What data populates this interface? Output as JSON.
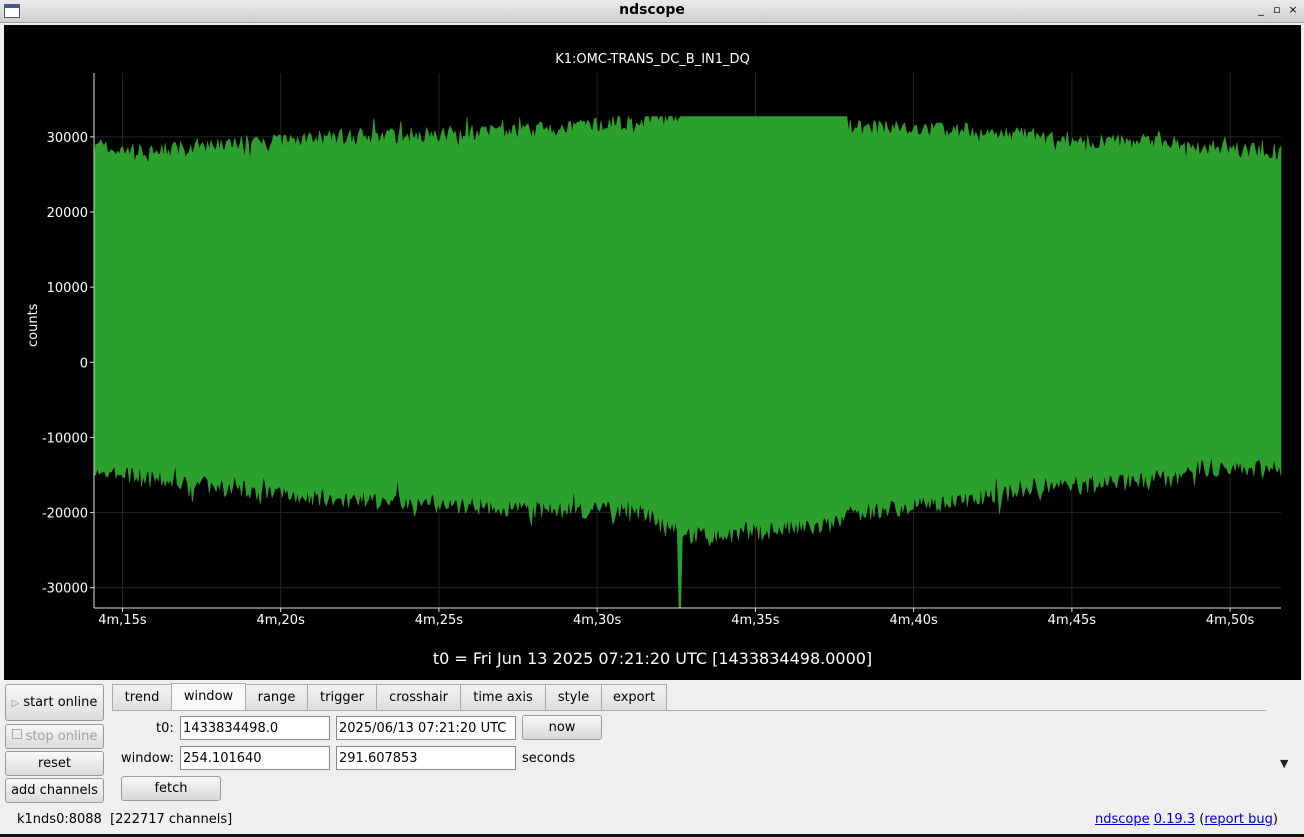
{
  "window": {
    "title": "ndscope",
    "controls": [
      "_",
      "▫",
      "×"
    ]
  },
  "plot": {
    "title": "K1:OMC-TRANS_DC_B_IN1_DQ",
    "ylabel": "counts",
    "t0_text": "t0 = Fri Jun 13 2025 07:21:20 UTC [1433834498.0000]",
    "trace_color": "#2ca02c"
  },
  "chart_data": {
    "type": "area",
    "title": "K1:OMC-TRANS_DC_B_IN1_DQ",
    "xlabel": "",
    "ylabel": "counts",
    "x_tick_labels": [
      "4m,15s",
      "4m,20s",
      "4m,25s",
      "4m,30s",
      "4m,35s",
      "4m,40s",
      "4m,45s",
      "4m,50s"
    ],
    "x_ticks_seconds": [
      255,
      260,
      265,
      270,
      275,
      280,
      285,
      290
    ],
    "y_tick_labels": [
      "30000",
      "20000",
      "10000",
      "0",
      "-10000",
      "-20000",
      "-30000"
    ],
    "y_ticks": [
      30000,
      20000,
      10000,
      0,
      -10000,
      -20000,
      -30000
    ],
    "xlim": [
      254.10164,
      291.607853
    ],
    "ylim": [
      -32700,
      38500
    ],
    "grid": true,
    "series": [
      {
        "color": "#2ca02c",
        "envelope_x": [
          254.1,
          256,
          258,
          260,
          262,
          264,
          266,
          268,
          270,
          271.5,
          272.6,
          273,
          274,
          275,
          276,
          277,
          277.8,
          278,
          280,
          282,
          284,
          286,
          288,
          289,
          291.6
        ],
        "envelope_max": [
          28500,
          28000,
          29000,
          29500,
          30000,
          30200,
          30500,
          30800,
          31500,
          32000,
          32700,
          32700,
          32700,
          32700,
          32700,
          32700,
          32700,
          31200,
          31000,
          30800,
          30000,
          29300,
          29200,
          28500,
          28000
        ],
        "envelope_min": [
          -14500,
          -15500,
          -16500,
          -17500,
          -18000,
          -18500,
          -19000,
          -19500,
          -19500,
          -20000,
          -22000,
          -23000,
          -23000,
          -22500,
          -22000,
          -22000,
          -21000,
          -20000,
          -19000,
          -18000,
          -16500,
          -16000,
          -15500,
          -14000,
          -14000
        ]
      }
    ]
  },
  "sidebar": {
    "start_online": "start online",
    "stop_online": "stop online",
    "reset": "reset",
    "add_channels": "add channels"
  },
  "tabs": [
    "trend",
    "window",
    "range",
    "trigger",
    "crosshair",
    "time axis",
    "style",
    "export"
  ],
  "active_tab": "window",
  "window_tab": {
    "t0_label": "t0:",
    "t0_gps": "1433834498.0",
    "t0_utc": "2025/06/13 07:21:20 UTC",
    "now_button": "now",
    "window_label": "window:",
    "window_start": "254.101640",
    "window_end": "291.607853",
    "seconds_label": "seconds",
    "fetch_button": "fetch"
  },
  "status": {
    "server": "k1nds0:8088",
    "channels": "[222717 channels]"
  },
  "version": {
    "app_link": "ndscope",
    "version_link": "0.19.3",
    "open_paren": " (",
    "report_link": "report bug",
    "close_paren": ")"
  }
}
